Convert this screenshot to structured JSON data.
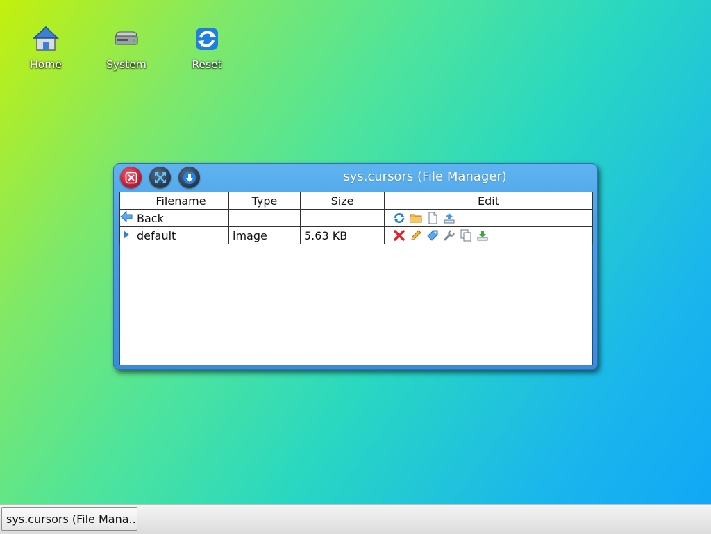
{
  "desktop": {
    "icons": [
      {
        "label": "Home",
        "icon": "home-icon"
      },
      {
        "label": "System",
        "icon": "drive-icon"
      },
      {
        "label": "Reset",
        "icon": "reset-icon"
      }
    ]
  },
  "window": {
    "title": "sys.cursors (File Manager)",
    "buttons": [
      "close-icon",
      "maximize-icon",
      "minimize-icon"
    ],
    "columns": [
      "Filename",
      "Type",
      "Size",
      "Edit"
    ],
    "rows": [
      {
        "name": "Back",
        "type": "",
        "size": "",
        "icon": "back-arrow-icon",
        "actions": [
          "refresh-icon",
          "folder-icon",
          "new-file-icon",
          "upload-icon"
        ]
      },
      {
        "name": "default",
        "type": "image",
        "size": "5.63 KB",
        "icon": "play-arrow-icon",
        "actions": [
          "delete-icon",
          "rename-icon",
          "tag-icon",
          "wrench-icon",
          "copy-icon",
          "download-icon"
        ]
      }
    ]
  },
  "taskbar": {
    "task_label": "sys.cursors (File Mana..."
  },
  "colors": {
    "window_blue": "#4aa0e6",
    "close_red": "#c81e35"
  }
}
